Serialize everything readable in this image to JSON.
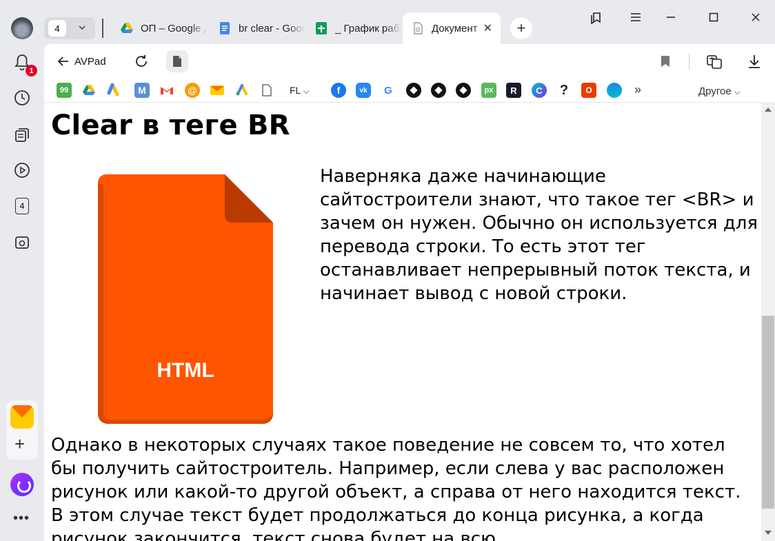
{
  "sidebar": {
    "notifications_count": "1",
    "tab_group_number": "4"
  },
  "tabs": {
    "open_count": "4",
    "items": [
      {
        "title": "ОП – Google Диск",
        "icon": "google-drive-icon"
      },
      {
        "title": "br clear - Google Документы",
        "icon": "google-docs-icon"
      },
      {
        "title": "_ График работы",
        "icon": "google-sheets-icon"
      },
      {
        "title": "Документ",
        "icon": "document-icon",
        "active": true
      }
    ],
    "close_glyph": "✕",
    "new_tab_glyph": "+"
  },
  "toolbar": {
    "back_label": "AVPad"
  },
  "bookmarks_bar": {
    "fl_label": "FL",
    "other_label": "Другое",
    "more_glyph": "»"
  },
  "page": {
    "heading": "Clear в теге BR",
    "image_label": "HTML",
    "paragraph1": "Наверняка даже начинающие сайтостроители знают, что такое тег <BR> и зачем он нужен. Обычно он используется для перевода строки. То есть этот тег останавливает непрерывный поток текста, и начинает вывод с новой строки.",
    "paragraph2": "Однако в некоторых случаях такое поведение не совсем то, что хотел бы получить сайтостроитель. Например, если слева у вас расположен рисунок или какой-то другой объект, а справа от него находится текст. В этом случае текст будет продолжаться до конца рисунка, а когда рисунок закончится, текст снова будет на всю"
  },
  "colors": {
    "html_icon": "#ff5500",
    "html_icon_fold": "#b83a00",
    "badge": "#e4002b"
  }
}
